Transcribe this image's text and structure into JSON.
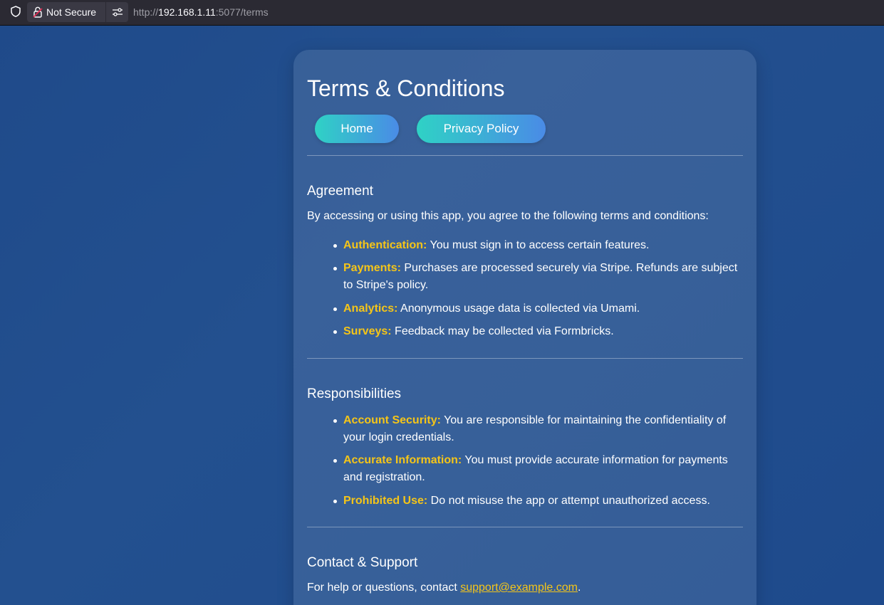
{
  "browser": {
    "security_label": "Not Secure",
    "url_prefix": "http://",
    "url_host": "192.168.1.11",
    "url_path": ":5077/terms"
  },
  "page": {
    "title": "Terms & Conditions",
    "nav": {
      "home_label": "Home",
      "privacy_label": "Privacy Policy"
    },
    "agreement": {
      "heading": "Agreement",
      "intro": "By accessing or using this app, you agree to the following terms and conditions:",
      "items": [
        {
          "key": "Authentication:",
          "text": " You must sign in to access certain features."
        },
        {
          "key": "Payments:",
          "text": " Purchases are processed securely via Stripe. Refunds are subject to Stripe's policy."
        },
        {
          "key": "Analytics:",
          "text": " Anonymous usage data is collected via Umami."
        },
        {
          "key": "Surveys:",
          "text": " Feedback may be collected via Formbricks."
        }
      ]
    },
    "responsibilities": {
      "heading": "Responsibilities",
      "items": [
        {
          "key": "Account Security:",
          "text": " You are responsible for maintaining the confidentiality of your login credentials."
        },
        {
          "key": "Accurate Information:",
          "text": " You must provide accurate information for payments and registration."
        },
        {
          "key": "Prohibited Use:",
          "text": " Do not misuse the app or attempt unauthorized access."
        }
      ]
    },
    "contact": {
      "heading": "Contact & Support",
      "text_before": "For help or questions, contact ",
      "email": "support@example.com",
      "text_after": "."
    }
  },
  "colors": {
    "accent_yellow": "#f5c518",
    "button_gradient_start": "#2fd2c5",
    "button_gradient_end": "#4a8be6",
    "background": "#1f4a8a"
  },
  "icons": {
    "shield": "shield-icon",
    "lock": "lock-broken-icon",
    "permissions": "permissions-sliders-icon"
  }
}
